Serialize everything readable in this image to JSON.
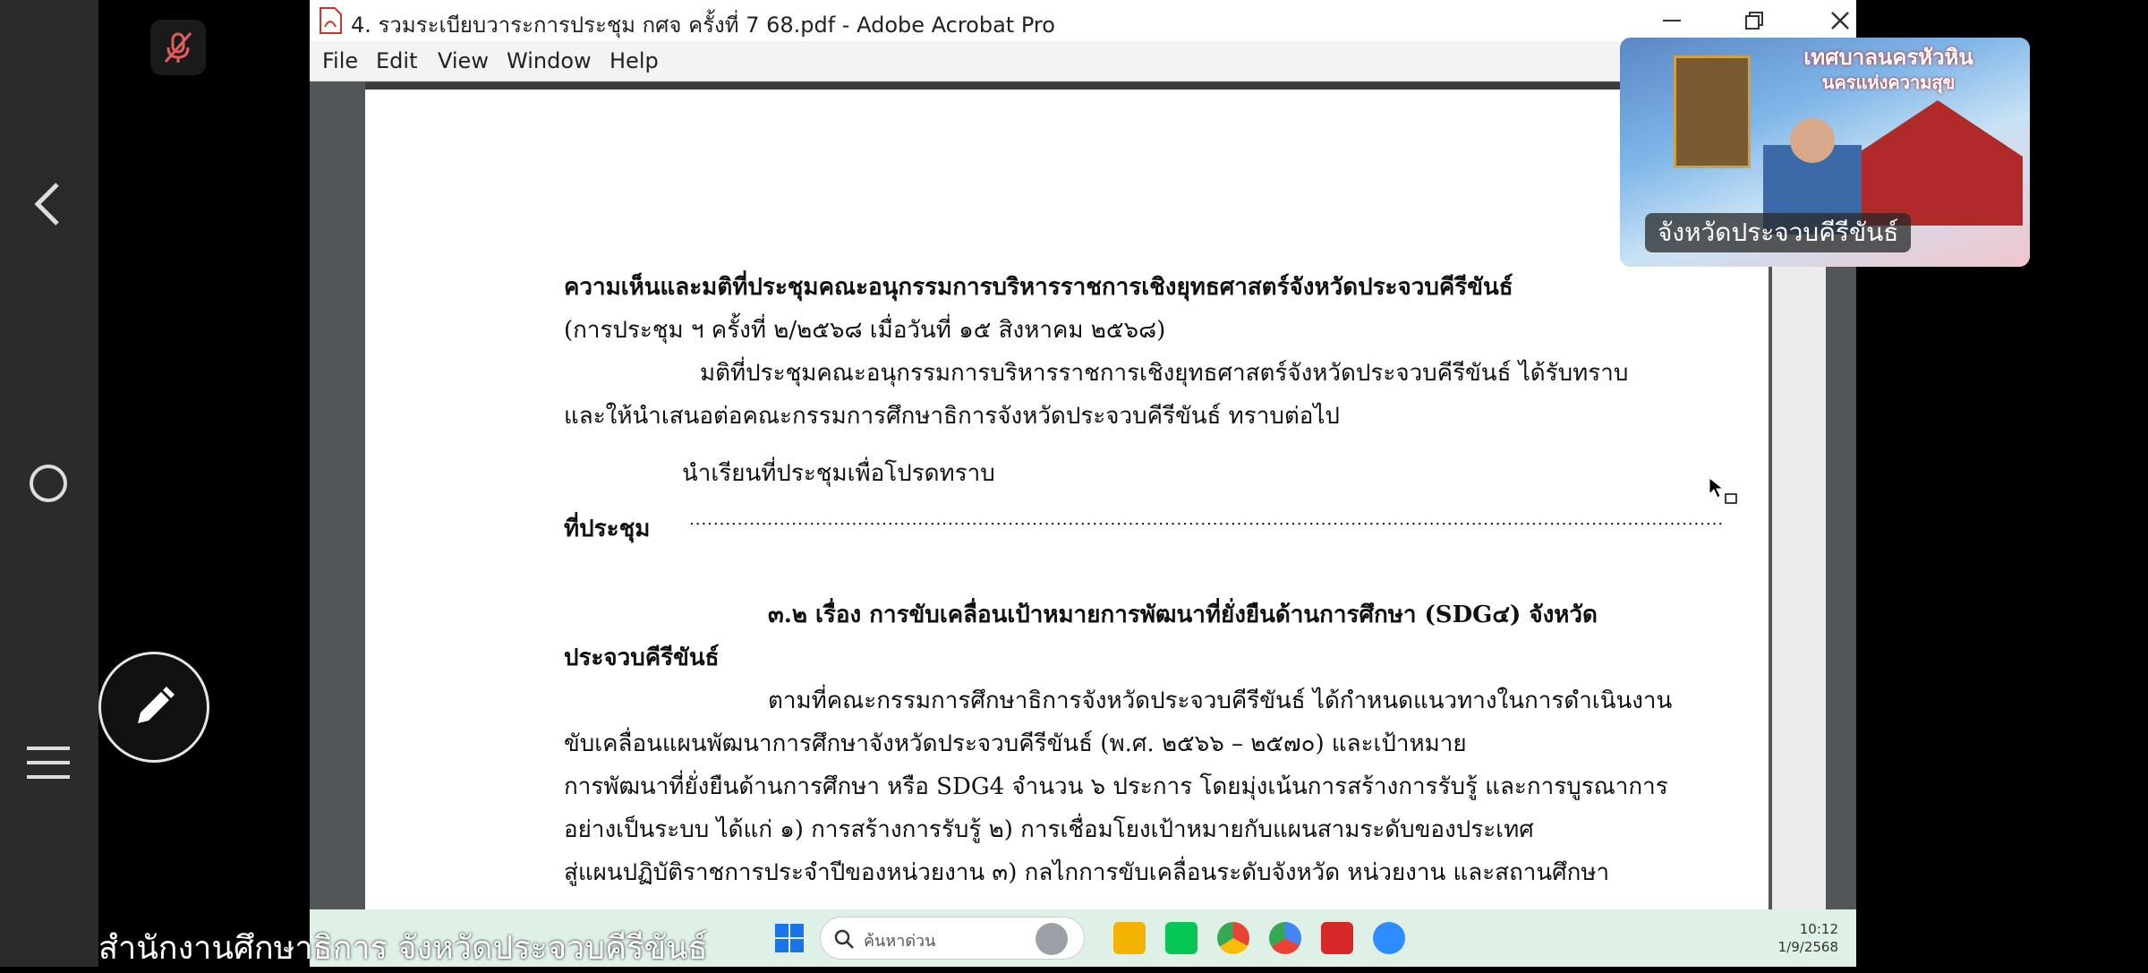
{
  "window": {
    "title": "4. รวมระเบียบวาระการประชุม กศจ  ครั้งที่ 7  68.pdf - Adobe Acrobat Pro"
  },
  "menu": [
    "File",
    "Edit",
    "View",
    "Window",
    "Help"
  ],
  "document": {
    "heading": "ความเห็นและมติที่ประชุมคณะอนุกรรมการบริหารราชการเชิงยุทธศาสตร์จังหวัดประจวบคีรีขันธ์",
    "subheading": "(การประชุม ฯ ครั้งที่ ๒/๒๕๖๘ เมื่อวันที่ ๑๕ สิงหาคม ๒๕๖๘)",
    "para1_line1": "มติที่ประชุมคณะอนุกรรมการบริหารราชการเชิงยุทธศาสตร์จังหวัดประจวบคีรีขันธ์ ได้รับทราบ",
    "para1_line2": "และให้นำเสนอต่อคณะกรรมการศึกษาธิการจังหวัดประจวบคีรีขันธ์ ทราบต่อไป",
    "notice": "นำเรียนที่ประชุมเพื่อโปรดทราบ",
    "meeting_label": "ที่ประชุม",
    "meeting_dots": "............................................................................................................................................................................",
    "section_line1": "๓.๒ เรื่อง การขับเคลื่อนเป้าหมายการพัฒนาที่ยั่งยืนด้านการศึกษา (SDG๔) จังหวัด",
    "section_line2": "ประจวบคีรีขันธ์",
    "body_lines": [
      "ตามที่คณะกรรมการศึกษาธิการจังหวัดประจวบคีรีขันธ์ ได้กำหนดแนวทางในการดำเนินงาน",
      "ขับเคลื่อนแผนพัฒนาการศึกษาจังหวัดประจวบคีรีขันธ์  (พ.ศ. ๒๕๖๖ – ๒๕๗๐) และเป้าหมาย",
      "การพัฒนาที่ยั่งยืนด้านการศึกษา หรือ SDG4 จำนวน ๖ ประการ โดยมุ่งเน้นการสร้างการรับรู้ และการบูรณาการ",
      "อย่างเป็นระบบ ได้แก่ ๑) การสร้างการรับรู้  ๒) การเชื่อมโยงเป้าหมายกับแผนสามระดับของประเทศ",
      "สู่แผนปฏิบัติราชการประจำปีของหน่วยงาน ๓)  กลไกการขับเคลื่อนระดับจังหวัด หน่วยงาน และสถานศึกษา"
    ]
  },
  "video": {
    "participant_label": "จังหวัดประจวบคีรีขันธ์",
    "banner_line1": "เทศบาลนครหัวหิน",
    "banner_line2": "นครแห่งความสุข"
  },
  "taskbar": {
    "search_text": "ค้นหาด่วน",
    "time": "10:12",
    "date": "1/9/2568"
  },
  "caption": "สำนักงานศึกษาธิการ จังหวัดประจวบคีรีขันธ์"
}
